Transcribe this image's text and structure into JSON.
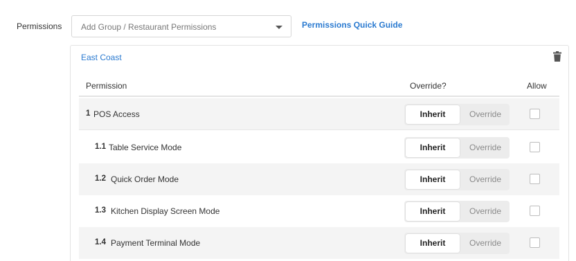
{
  "permissions_label": "Permissions",
  "select": {
    "placeholder": "Add Group / Restaurant Permissions"
  },
  "quick_guide_link": "Permissions Quick Guide",
  "group": {
    "name": "East Coast",
    "headers": {
      "permission": "Permission",
      "override": "Override?",
      "allow": "Allow"
    },
    "rows": [
      {
        "num": "1",
        "label": "POS Access",
        "inherit": "Inherit",
        "override": "Override",
        "allowed": false
      },
      {
        "num": "1.1",
        "label": "Table Service Mode",
        "inherit": "Inherit",
        "override": "Override",
        "allowed": false
      },
      {
        "num": "1.2",
        "label": "Quick Order Mode",
        "inherit": "Inherit",
        "override": "Override",
        "allowed": false
      },
      {
        "num": "1.3",
        "label": "Kitchen Display Screen Mode",
        "inherit": "Inherit",
        "override": "Override",
        "allowed": false
      },
      {
        "num": "1.4",
        "label": "Payment Terminal Mode",
        "inherit": "Inherit",
        "override": "Override",
        "allowed": false
      }
    ]
  },
  "icons": {
    "trash": "trash-icon",
    "caret": "chevron-down-icon"
  },
  "colors": {
    "link": "#2a7ad0",
    "row_shade": "#f4f4f4",
    "segment_bg": "#ececec"
  }
}
